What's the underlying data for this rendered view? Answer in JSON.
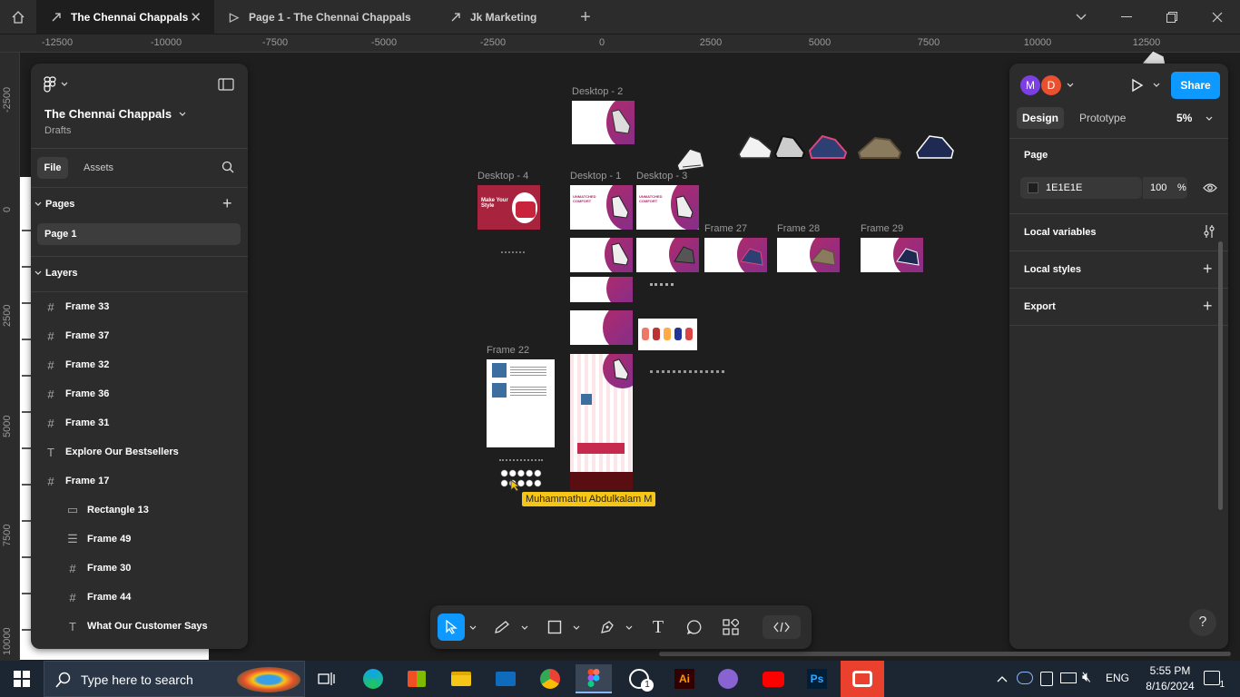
{
  "tabs": [
    {
      "label": "The Chennai Chappals",
      "active": true
    },
    {
      "label": "Page 1 - The Chennai Chappals",
      "active": false
    },
    {
      "label": "Jk Marketing",
      "active": false
    }
  ],
  "ruler": {
    "h": [
      "-12500",
      "-10000",
      "-7500",
      "-5000",
      "-2500",
      "0",
      "2500",
      "5000",
      "7500",
      "10000",
      "12500"
    ],
    "v": [
      "-2500",
      "0",
      "2500",
      "5000",
      "7500",
      "10000"
    ]
  },
  "left": {
    "file_title": "The Chennai Chappals",
    "file_sub": "Drafts",
    "tab_file": "File",
    "tab_assets": "Assets",
    "pages_header": "Pages",
    "pages": [
      "Page 1"
    ],
    "layers_header": "Layers",
    "layers": [
      {
        "label": "Frame 33",
        "icon": "frame",
        "indent": 0
      },
      {
        "label": "Frame 37",
        "icon": "frame",
        "indent": 0
      },
      {
        "label": "Frame 32",
        "icon": "frame",
        "indent": 0
      },
      {
        "label": "Frame 36",
        "icon": "frame",
        "indent": 0
      },
      {
        "label": "Frame 31",
        "icon": "frame",
        "indent": 0
      },
      {
        "label": "Explore Our Bestsellers",
        "icon": "text",
        "indent": 0
      },
      {
        "label": "Frame 17",
        "icon": "frame",
        "indent": 0
      },
      {
        "label": "Rectangle 13",
        "icon": "rect",
        "indent": 1
      },
      {
        "label": "Frame 49",
        "icon": "autolayout",
        "indent": 1
      },
      {
        "label": "Frame 30",
        "icon": "frame",
        "indent": 1
      },
      {
        "label": "Frame 44",
        "icon": "frame",
        "indent": 1
      },
      {
        "label": "What Our Customer Says",
        "icon": "text",
        "indent": 1
      }
    ]
  },
  "right": {
    "avatars": [
      "M",
      "D"
    ],
    "avatar_colors": [
      "#7b3fe4",
      "#e8502f"
    ],
    "share": "Share",
    "tab_design": "Design",
    "tab_prototype": "Prototype",
    "zoom": "5%",
    "page_header": "Page",
    "page_color": "1E1E1E",
    "page_opacity": "100",
    "percent": "%",
    "local_variables": "Local variables",
    "local_styles": "Local styles",
    "export": "Export"
  },
  "canvas": {
    "frames": {
      "desktop2": "Desktop - 2",
      "desktop4": "Desktop - 4",
      "desktop1": "Desktop - 1",
      "desktop3": "Desktop - 3",
      "frame27": "Frame 27",
      "frame28": "Frame 28",
      "frame29": "Frame 29",
      "frame22": "Frame 22"
    },
    "cursor_label": "Muhammathu Abdulkalam M",
    "cursor_color": "#f5c518"
  },
  "taskbar": {
    "search_placeholder": "Type here to search",
    "lang": "ENG",
    "time": "5:55 PM",
    "date": "8/16/2024",
    "notif_count": "1"
  }
}
